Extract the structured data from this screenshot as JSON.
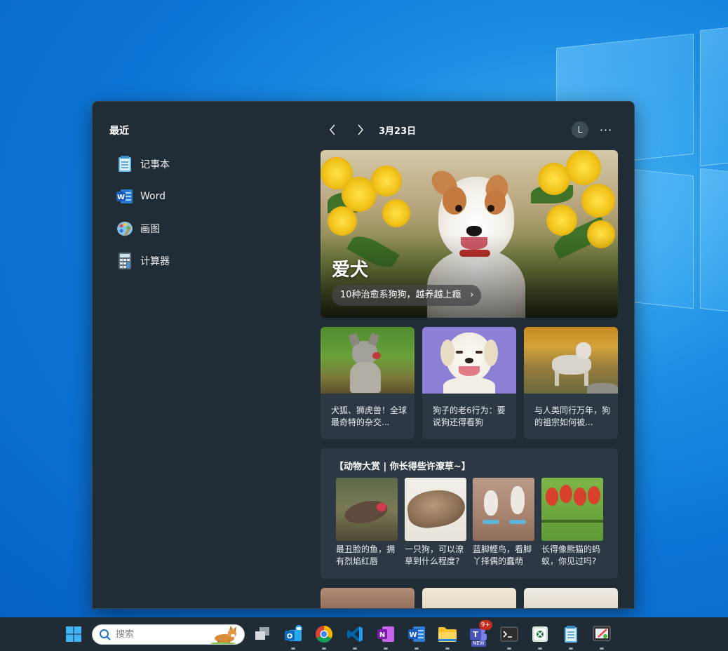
{
  "widgets": {
    "recent_title": "最近",
    "recent_items": [
      {
        "label": "记事本",
        "icon": "notepad-icon"
      },
      {
        "label": "Word",
        "icon": "word-icon"
      },
      {
        "label": "画图",
        "icon": "paint-icon"
      },
      {
        "label": "计算器",
        "icon": "calculator-icon"
      }
    ],
    "date": "3月23日",
    "avatar_initial": "L",
    "more_label": "···"
  },
  "feed": {
    "hero": {
      "title": "爱犬",
      "link_text": "10种治愈系狗狗，越养越上瘾",
      "chevron": "›"
    },
    "cards": [
      {
        "text": "犬狐、狮虎兽！全球最奇特的杂交..."
      },
      {
        "text": "狗子的老6行为：要说狗还得看狗"
      },
      {
        "text": "与人类同行万年，狗的祖宗如何被..."
      }
    ],
    "gallery": {
      "title": "【动物大赏 | 你长得些许潦草~】",
      "items": [
        {
          "text": "最丑脸的鱼，拥有烈焰红唇"
        },
        {
          "text": "一只狗，可以潦草到什么程度?"
        },
        {
          "text": "蓝脚鲣鸟，看脚丫择偶的蠢萌"
        },
        {
          "text": "长得像熊猫的蚂蚁，你见过吗?"
        }
      ]
    }
  },
  "taskbar": {
    "search_placeholder": "搜索",
    "teams_badge": "9+",
    "teams_new_label": "NEW",
    "onenote_letter": "N",
    "word_letter": "W",
    "outlook_letter": "O",
    "teams_letter": "T"
  },
  "colors": {
    "panel_bg": "#202c36",
    "card_bg": "#2c3944",
    "taskbar_bg": "#1f2b35",
    "accent_blue": "#0a78dc"
  }
}
